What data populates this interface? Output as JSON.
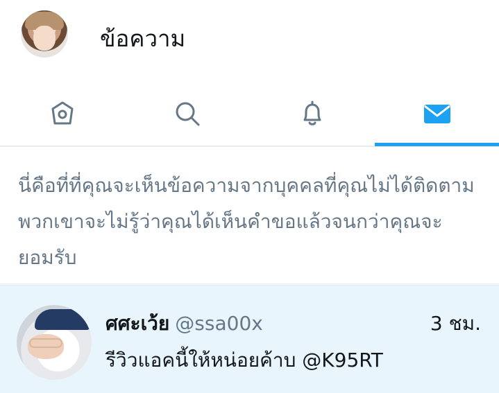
{
  "header": {
    "title": "ข้อความ",
    "avatar_icon": "profile-avatar"
  },
  "tabs": [
    {
      "name": "home",
      "icon": "home-icon",
      "active": false
    },
    {
      "name": "search",
      "icon": "search-icon",
      "active": false
    },
    {
      "name": "notifications",
      "icon": "bell-icon",
      "active": false
    },
    {
      "name": "messages",
      "icon": "mail-icon",
      "active": true
    }
  ],
  "info": {
    "text": "นี่คือที่ที่คุณจะเห็นข้อความจากบุคคลที่คุณไม่ได้ติดตาม พวกเขาจะไม่รู้ว่าคุณได้เห็นคำขอแล้วจนกว่าคุณจะยอมรับ"
  },
  "conversation": {
    "name": "ศศะเว้ย",
    "handle": "@ssa00x",
    "time": "3 ชม.",
    "preview": "รีวิวแอคนี้ให้หน่อยค้าบ @K95RT"
  },
  "colors": {
    "accent": "#1da1f2",
    "icon_gray": "#657786",
    "highlight_bg": "#e8f5fd",
    "text_gray": "#657786"
  }
}
